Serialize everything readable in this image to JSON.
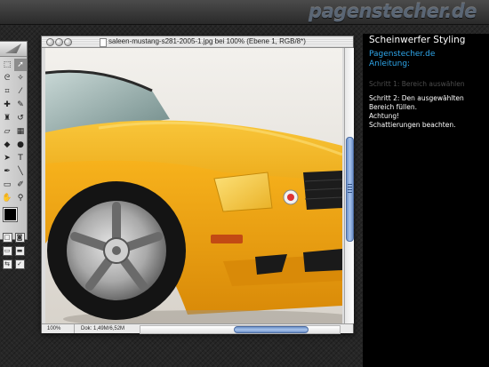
{
  "site_logo": "pagenstecher.de",
  "document": {
    "title": "saleen-mustang-s281-2005-1.jpg bei 100% (Ebene 1, RGB/8*)",
    "zoom": "100%",
    "doc_size": "Dok: 1,49M/6,52M"
  },
  "toolbox": {
    "tools": [
      {
        "icon": "marquee-icon",
        "glyph": "⬚",
        "selected": false
      },
      {
        "icon": "move-icon",
        "glyph": "➚",
        "selected": true
      },
      {
        "icon": "lasso-icon",
        "glyph": "ᘓ",
        "selected": false
      },
      {
        "icon": "magic-wand-icon",
        "glyph": "✧",
        "selected": false
      },
      {
        "icon": "crop-icon",
        "glyph": "⌗",
        "selected": false
      },
      {
        "icon": "slice-icon",
        "glyph": "⁄",
        "selected": false
      },
      {
        "icon": "healing-brush-icon",
        "glyph": "✚",
        "selected": false
      },
      {
        "icon": "brush-icon",
        "glyph": "✎",
        "selected": false
      },
      {
        "icon": "clone-stamp-icon",
        "glyph": "♜",
        "selected": false
      },
      {
        "icon": "history-brush-icon",
        "glyph": "↺",
        "selected": false
      },
      {
        "icon": "eraser-icon",
        "glyph": "▱",
        "selected": false
      },
      {
        "icon": "gradient-icon",
        "glyph": "▦",
        "selected": false
      },
      {
        "icon": "blur-icon",
        "glyph": "◆",
        "selected": false
      },
      {
        "icon": "dodge-icon",
        "glyph": "●",
        "selected": false
      },
      {
        "icon": "path-select-icon",
        "glyph": "➤",
        "selected": false
      },
      {
        "icon": "type-icon",
        "glyph": "T",
        "selected": false
      },
      {
        "icon": "pen-icon",
        "glyph": "✒",
        "selected": false
      },
      {
        "icon": "line-icon",
        "glyph": "╲",
        "selected": false
      },
      {
        "icon": "notes-icon",
        "glyph": "▭",
        "selected": false
      },
      {
        "icon": "eyedropper-icon",
        "glyph": "✐",
        "selected": false
      },
      {
        "icon": "hand-icon",
        "glyph": "✋",
        "selected": false
      },
      {
        "icon": "zoom-icon",
        "glyph": "⚲",
        "selected": false
      }
    ]
  },
  "panel": {
    "title": "Scheinwerfer Styling",
    "site": "Pagenstecher.de",
    "subtitle": "Anleitung:",
    "step1": "Schritt 1: Bereich auswählen",
    "step2_lines": [
      "Schritt 2: Den ausgewählten",
      "Bereich füllen.",
      "Achtung!",
      "Schattierungen beachten."
    ]
  },
  "colors": {
    "car_yellow": "#f5ae1a",
    "accent_blue": "#2fa6ea",
    "scroll_blue": "#6d91c8"
  }
}
